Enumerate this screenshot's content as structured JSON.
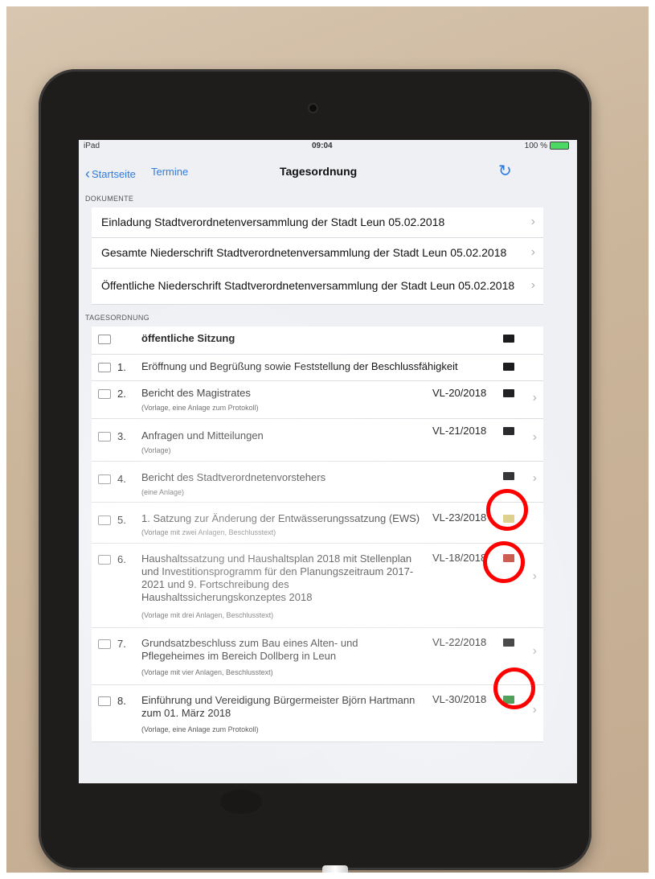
{
  "status": {
    "device": "iPad",
    "time": "09:04",
    "battery": "100 %"
  },
  "nav": {
    "back_label": "Startseite",
    "termine_label": "Termine",
    "title": "Tagesordnung"
  },
  "documents": {
    "header": "DOKUMENTE",
    "items": [
      "Einladung Stadtverordnetenversammlung der Stadt Leun 05.02.2018",
      "Gesamte Niederschrift Stadtverordnetenversammlung der Stadt Leun 05.02.2018",
      "Öffentliche Niederschrift Stadtverordnetenversammlung der Stadt Leun 05.02.2018"
    ]
  },
  "agenda": {
    "header": "TAGESORDNUNG",
    "items": [
      {
        "num": "",
        "title": "öffentliche Sitzung",
        "sub": "",
        "vl": "",
        "folder": "black"
      },
      {
        "num": "1.",
        "title": "Eröffnung und Begrüßung sowie Feststellung der Beschlussfähigkeit",
        "sub": "",
        "vl": "",
        "folder": "black"
      },
      {
        "num": "2.",
        "title": "Bericht des Magistrates",
        "sub": "(Vorlage, eine Anlage zum Protokoll)",
        "vl": "VL-20/2018",
        "folder": "black"
      },
      {
        "num": "3.",
        "title": "Anfragen und Mitteilungen",
        "sub": "(Vorlage)",
        "vl": "VL-21/2018",
        "folder": "black"
      },
      {
        "num": "4.",
        "title": "Bericht des Stadtverordnetenvorstehers",
        "sub": "(eine Anlage)",
        "vl": "",
        "folder": "black"
      },
      {
        "num": "5.",
        "title": "1. Satzung zur Änderung der Entwässerungssatzung (EWS)",
        "sub": "(Vorlage mit zwei Anlagen, Beschlusstext)",
        "vl": "VL-23/2018",
        "folder": "yellow"
      },
      {
        "num": "6.",
        "title": "Haushaltssatzung und Haushaltsplan 2018 mit Stellenplan und Investitionsprogramm für den Planungszeitraum 2017-2021 und 9. Fortschreibung des Haushaltssicherungskonzeptes 2018",
        "sub": "(Vorlage mit drei Anlagen, Beschlusstext)",
        "vl": "VL-18/2018",
        "folder": "red"
      },
      {
        "num": "7.",
        "title": "Grundsatzbeschluss zum Bau eines Alten- und Pflegeheimes im Bereich Dollberg in Leun",
        "sub": "(Vorlage mit vier Anlagen, Beschlusstext)",
        "vl": "VL-22/2018",
        "folder": "black"
      },
      {
        "num": "8.",
        "title": "Einführung und Vereidigung Bürgermeister Björn Hartmann zum 01. März 2018",
        "sub": "(Vorlage, eine Anlage zum Protokoll)",
        "vl": "VL-30/2018",
        "folder": "green"
      }
    ]
  },
  "colors": {
    "accent": "#2f7be0",
    "highlight_circle": "#ff0000",
    "folder_yellow": "#d8c97a",
    "folder_red": "#c0392b",
    "folder_green": "#2e8b3a"
  }
}
